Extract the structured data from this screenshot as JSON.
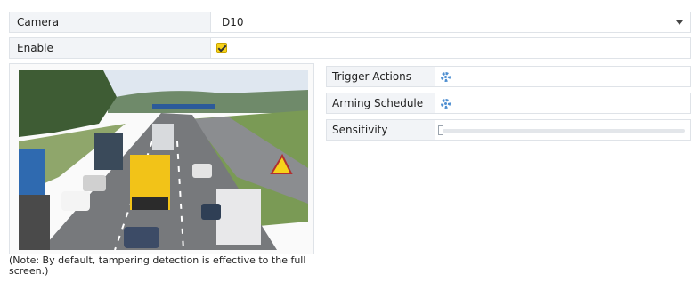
{
  "camera": {
    "label": "Camera",
    "value": "D10"
  },
  "enable": {
    "label": "Enable",
    "checked": true
  },
  "preview": {
    "description_icon": "highway-traffic-image"
  },
  "note": "(Note: By default, tampering detection is effective to the full screen.)",
  "settings": {
    "trigger_actions": {
      "label": "Trigger Actions",
      "icon": "gear-icon"
    },
    "arming_schedule": {
      "label": "Arming Schedule",
      "icon": "gear-icon"
    },
    "sensitivity": {
      "label": "Sensitivity",
      "value": 0
    }
  },
  "colors": {
    "accent": "#4f8fd1",
    "checkbox": "#f7d21a",
    "label_bg": "#f2f4f7",
    "border": "#dfe3e8"
  }
}
